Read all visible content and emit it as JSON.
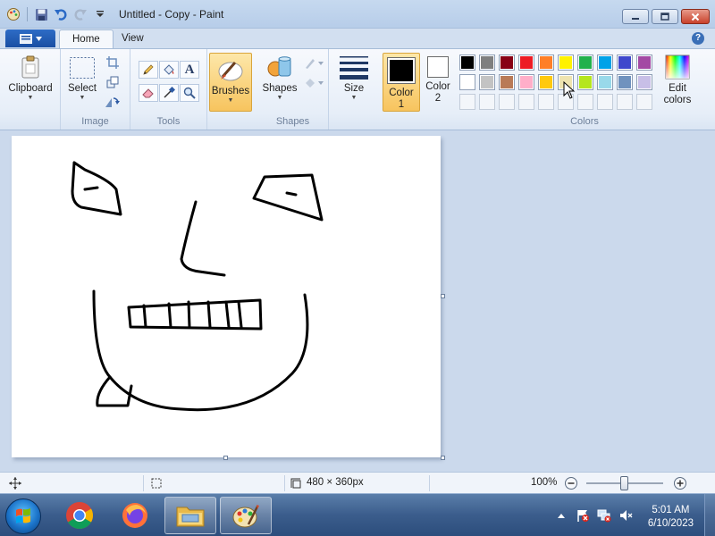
{
  "window": {
    "title": "Untitled - Copy - Paint"
  },
  "tabs": {
    "home": "Home",
    "view": "View"
  },
  "ribbon": {
    "clipboard": {
      "label": "Clipboard"
    },
    "image": {
      "select_label": "Select",
      "group_label": "Image"
    },
    "tools": {
      "group_label": "Tools",
      "text_tool": "A"
    },
    "brushes": {
      "label": "Brushes"
    },
    "shapes": {
      "label": "Shapes",
      "group_label": "Shapes"
    },
    "size": {
      "label": "Size"
    },
    "colors": {
      "color1_label": "Color 1",
      "color2_label": "Color 2",
      "edit_colors_label": "Edit colors",
      "group_label": "Colors",
      "color1_value": "#000000",
      "color2_value": "#ffffff",
      "palette_row1": [
        "#000000",
        "#7f7f7f",
        "#880015",
        "#ed1c24",
        "#ff7f27",
        "#fff200",
        "#22b14c",
        "#00a2e8",
        "#3f48cc",
        "#a349a4"
      ],
      "palette_row2": [
        "#ffffff",
        "#c3c3c3",
        "#b97a57",
        "#ffaec9",
        "#ffc90e",
        "#efe4b0",
        "#b5e61d",
        "#99d9ea",
        "#7092be",
        "#c8bfe7"
      ]
    }
  },
  "statusbar": {
    "dimensions": "480 × 360px",
    "zoom": "100%"
  },
  "taskbar": {
    "time": "5:01 AM",
    "date": "6/10/2023"
  }
}
